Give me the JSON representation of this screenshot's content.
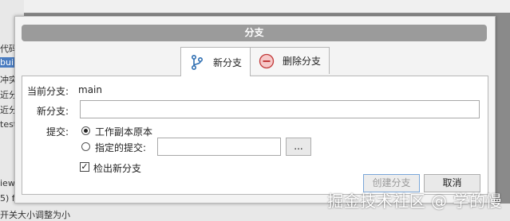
{
  "background": {
    "lines": [
      "代码",
      "buil",
      "冲突",
      "近分",
      "近分",
      "test-",
      "iew",
      "5) f",
      "开关大小调整为小"
    ]
  },
  "dialog": {
    "title": "分支",
    "tabs": [
      {
        "label": "新分支",
        "icon": "branch-icon"
      },
      {
        "label": "删除分支",
        "icon": "minus-circle-icon"
      }
    ],
    "current_branch_label": "当前分支:",
    "current_branch_value": "main",
    "new_branch_label": "新分支:",
    "new_branch_value": "",
    "commit_label": "提交:",
    "radio_working_copy": "工作副本原本",
    "radio_specified_commit": "指定的提交:",
    "specified_commit_value": "",
    "browse_button": "...",
    "checkout_label": "检出新分支",
    "create_button": "创建分支",
    "cancel_button": "取消"
  },
  "watermark": "掘金技术社区 @ 学的慢",
  "colors": {
    "accent": "#c23a3a",
    "branch_icon": "#2f6fb2"
  }
}
